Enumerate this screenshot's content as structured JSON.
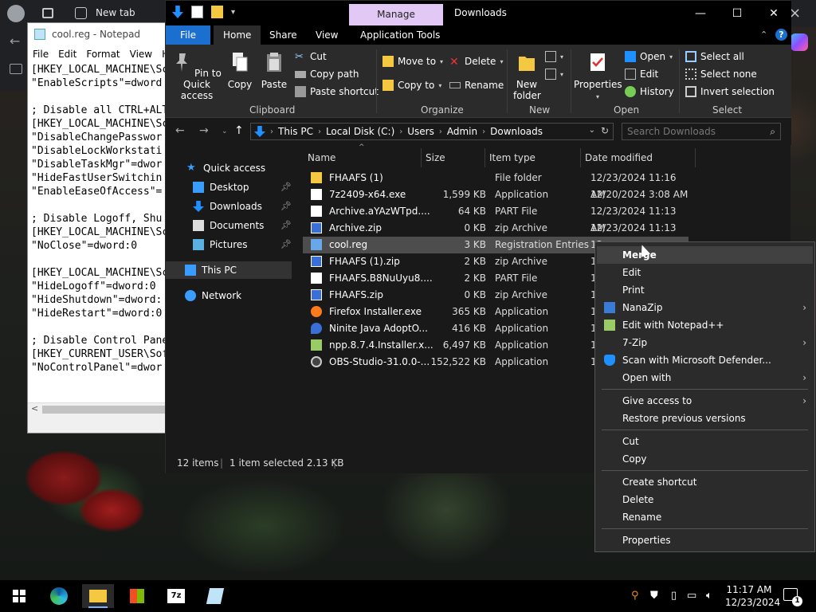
{
  "browser": {
    "tab_title": "New tab"
  },
  "notepad": {
    "title": "cool.reg - Notepad",
    "menu": [
      "File",
      "Edit",
      "Format",
      "View",
      "H"
    ],
    "lines": [
      "[HKEY_LOCAL_MACHINE\\Sc",
      "\"EnableScripts\"=dword",
      "",
      "; Disable all CTRL+ALT",
      "[HKEY_LOCAL_MACHINE\\Sc",
      "\"DisableChangePasswor",
      "\"DisableLockWorkstati",
      "\"DisableTaskMgr\"=dwor",
      "\"HideFastUserSwitchin",
      "\"EnableEaseOfAccess\"=",
      "",
      "; Disable Logoff, Shu",
      "[HKEY_LOCAL_MACHINE\\Sc",
      "\"NoClose\"=dword:0",
      "",
      "[HKEY_LOCAL_MACHINE\\Sc",
      "\"HideLogoff\"=dword:0",
      "\"HideShutdown\"=dword:",
      "\"HideRestart\"=dword:0",
      "",
      "; Disable Control Pane",
      "[HKEY_CURRENT_USER\\Sof",
      "\"NoControlPanel\"=dwor"
    ]
  },
  "explorer": {
    "title": "Downloads",
    "manage_tab": "Manage",
    "tabs": {
      "file": "File",
      "home": "Home",
      "share": "Share",
      "view": "View",
      "apptools": "Application Tools"
    },
    "ribbon": {
      "pin": "Pin to Quick access",
      "copy": "Copy",
      "paste": "Paste",
      "cut": "Cut",
      "copy_path": "Copy path",
      "paste_shortcut": "Paste shortcut",
      "clipboard": "Clipboard",
      "move_to": "Move to",
      "copy_to": "Copy to",
      "delete": "Delete",
      "rename": "Rename",
      "organize": "Organize",
      "new_folder": "New folder",
      "new": "New",
      "properties": "Properties",
      "open": "Open",
      "edit": "Edit",
      "history": "History",
      "open_group": "Open",
      "select_all": "Select all",
      "select_none": "Select none",
      "invert_selection": "Invert selection",
      "select": "Select"
    },
    "address": {
      "crumbs": [
        "This PC",
        "Local Disk (C:)",
        "Users",
        "Admin",
        "Downloads"
      ]
    },
    "search_placeholder": "Search Downloads",
    "nav": {
      "quick_access": "Quick access",
      "desktop": "Desktop",
      "downloads": "Downloads",
      "documents": "Documents",
      "pictures": "Pictures",
      "this_pc": "This PC",
      "network": "Network"
    },
    "columns": {
      "name": "Name",
      "size": "Size",
      "type": "Item type",
      "date": "Date modified"
    },
    "files": [
      {
        "name": "FHAAFS (1)",
        "size": "",
        "type": "File folder",
        "date": "12/23/2024 11:16 AM",
        "icon": "folder"
      },
      {
        "name": "7z2409-x64.exe",
        "size": "1,599 KB",
        "type": "Application",
        "date": "12/20/2024 3:08 AM",
        "icon": "7z"
      },
      {
        "name": "Archive.aYAzWTpd....",
        "size": "64 KB",
        "type": "PART File",
        "date": "12/23/2024 11:13 AM",
        "icon": "doc"
      },
      {
        "name": "Archive.zip",
        "size": "0 KB",
        "type": "zip Archive",
        "date": "12/23/2024 11:13 AM",
        "icon": "zip"
      },
      {
        "name": "cool.reg",
        "size": "3 KB",
        "type": "Registration Entries",
        "date": "12",
        "icon": "reg"
      },
      {
        "name": "FHAAFS (1).zip",
        "size": "2 KB",
        "type": "zip Archive",
        "date": "12",
        "icon": "zip"
      },
      {
        "name": "FHAAFS.B8NuUyu8....",
        "size": "2 KB",
        "type": "PART File",
        "date": "12",
        "icon": "doc"
      },
      {
        "name": "FHAAFS.zip",
        "size": "0 KB",
        "type": "zip Archive",
        "date": "12",
        "icon": "zip"
      },
      {
        "name": "Firefox Installer.exe",
        "size": "365 KB",
        "type": "Application",
        "date": "12",
        "icon": "firefox"
      },
      {
        "name": "Ninite Java AdoptO...",
        "size": "416 KB",
        "type": "Application",
        "date": "12",
        "icon": "ninite"
      },
      {
        "name": "npp.8.7.4.Installer.x...",
        "size": "6,497 KB",
        "type": "Application",
        "date": "12",
        "icon": "npp"
      },
      {
        "name": "OBS-Studio-31.0.0-...",
        "size": "152,522 KB",
        "type": "Application",
        "date": "12",
        "icon": "obs"
      }
    ],
    "status": {
      "items": "12 items",
      "selected": "1 item selected  2.13 KB"
    }
  },
  "context_menu": {
    "merge": "Merge",
    "edit": "Edit",
    "print": "Print",
    "nanozip": "NanaZip",
    "edit_npp": "Edit with Notepad++",
    "sevenzip": "7-Zip",
    "defender": "Scan with Microsoft Defender...",
    "open_with": "Open with",
    "give_access": "Give access to",
    "restore": "Restore previous versions",
    "cut": "Cut",
    "copy": "Copy",
    "create_shortcut": "Create shortcut",
    "delete": "Delete",
    "rename": "Rename",
    "properties": "Properties"
  },
  "taskbar": {
    "time": "11:17 AM",
    "date": "12/23/2024",
    "notifications": "1"
  },
  "colors": {
    "accent": "#1a6fcf",
    "manage": "#e2c8f5",
    "folder": "#f5c842"
  }
}
